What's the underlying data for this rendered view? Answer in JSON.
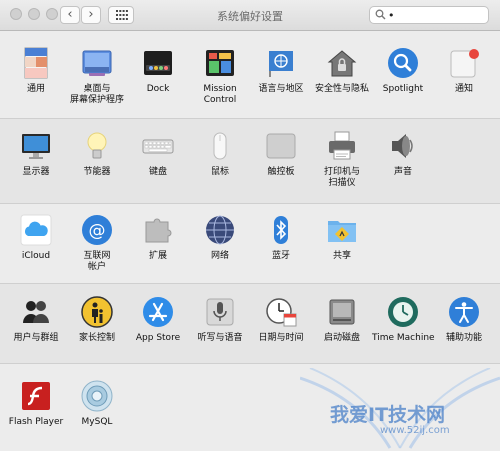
{
  "window": {
    "title": "系统偏好设置"
  },
  "search": {
    "value": "•",
    "placeholder": ""
  },
  "panes": {
    "general": {
      "label": "通用"
    },
    "desktop": {
      "line1": "桌面与",
      "line2": "屏幕保护程序"
    },
    "dock": {
      "label": "Dock"
    },
    "mission": {
      "line1": "Mission",
      "line2": "Control"
    },
    "language": {
      "label": "语言与地区"
    },
    "security": {
      "label": "安全性与隐私"
    },
    "spotlight": {
      "label": "Spotlight"
    },
    "notifications": {
      "label": "通知"
    },
    "displays": {
      "label": "显示器"
    },
    "energy": {
      "label": "节能器"
    },
    "keyboard": {
      "label": "键盘"
    },
    "mouse": {
      "label": "鼠标"
    },
    "trackpad": {
      "label": "触控板"
    },
    "printers": {
      "line1": "打印机与",
      "line2": "扫描仪"
    },
    "sound": {
      "label": "声音"
    },
    "icloud": {
      "label": "iCloud"
    },
    "internet": {
      "line1": "互联网",
      "line2": "帐户"
    },
    "extensions": {
      "label": "扩展"
    },
    "network": {
      "label": "网络"
    },
    "bluetooth": {
      "label": "蓝牙"
    },
    "sharing": {
      "label": "共享"
    },
    "users": {
      "label": "用户与群组"
    },
    "parental": {
      "label": "家长控制"
    },
    "appstore": {
      "label": "App Store"
    },
    "dictation": {
      "label": "听写与语音"
    },
    "datetime": {
      "label": "日期与时间"
    },
    "startup": {
      "label": "启动磁盘"
    },
    "timemachine": {
      "label": "Time Machine"
    },
    "accessibility": {
      "label": "辅助功能"
    },
    "flash": {
      "label": "Flash Player"
    },
    "mysql": {
      "label": "MySQL"
    }
  },
  "watermark": {
    "text": "我爱IT技术网",
    "url": "www.52ij.com"
  },
  "colors": {
    "accent": "#2f7fd8",
    "notification_dot": "#e8453c"
  }
}
